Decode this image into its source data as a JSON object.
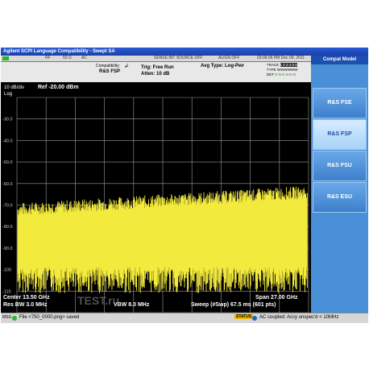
{
  "window": {
    "title": "Agilent SCPI Language Compatibility - Swept SA"
  },
  "status_row": {
    "rf": "RF",
    "impedance": "50 Ω",
    "coupling": "AC",
    "sense": "SENSE:INT  SOURCE OFF",
    "align": "ALIGN OFF",
    "datetime": "03:06:06 PM Dec 09, 2011"
  },
  "info": {
    "compatibility_label": "Compatibility:",
    "compatibility_value": "R&S FSP",
    "trig": "Trig: Free Run",
    "atten": "Atten: 10 dB",
    "avg_type": "Avg Type: Log-Pwr",
    "trace_label": "TRACE",
    "trace_value": "1 2 3 4 5 6",
    "type_label": "TYPE",
    "type_value": "WWWWWW",
    "det_label": "DET",
    "det_value": "N N N N N N"
  },
  "plot": {
    "scale": "10 dB/div",
    "ref": "Ref -20.00 dBm",
    "log": "Log",
    "y_ticks": [
      "-30.0",
      "-40.0",
      "-50.0",
      "-60.0",
      "-70.0",
      "-80.0",
      "-90.0",
      "-100",
      "-110"
    ],
    "trace_color": "#f2ea3c",
    "center": "Center 13.50 GHz",
    "res_bw": "Res BW 3.0 MHz",
    "vbw": "VBW 8.0 MHz",
    "span": "Span 27.00 GHz",
    "sweep": "Sweep (#Swp)  67.5 ms (601 pts)"
  },
  "softkeys": {
    "header": "Compat Model",
    "items": [
      "R&S FSE",
      "R&S FSP",
      "R&S FSU",
      "R&S ESU"
    ],
    "active_index": 1
  },
  "message": {
    "msg_label": "MSG",
    "file_text": "File <750_0000.png> saved",
    "status_label": "STATUS",
    "status_text": "AC coupled: Accy unspec'd < 10MHz"
  },
  "watermark": {
    "text": "TEST.ru"
  }
}
